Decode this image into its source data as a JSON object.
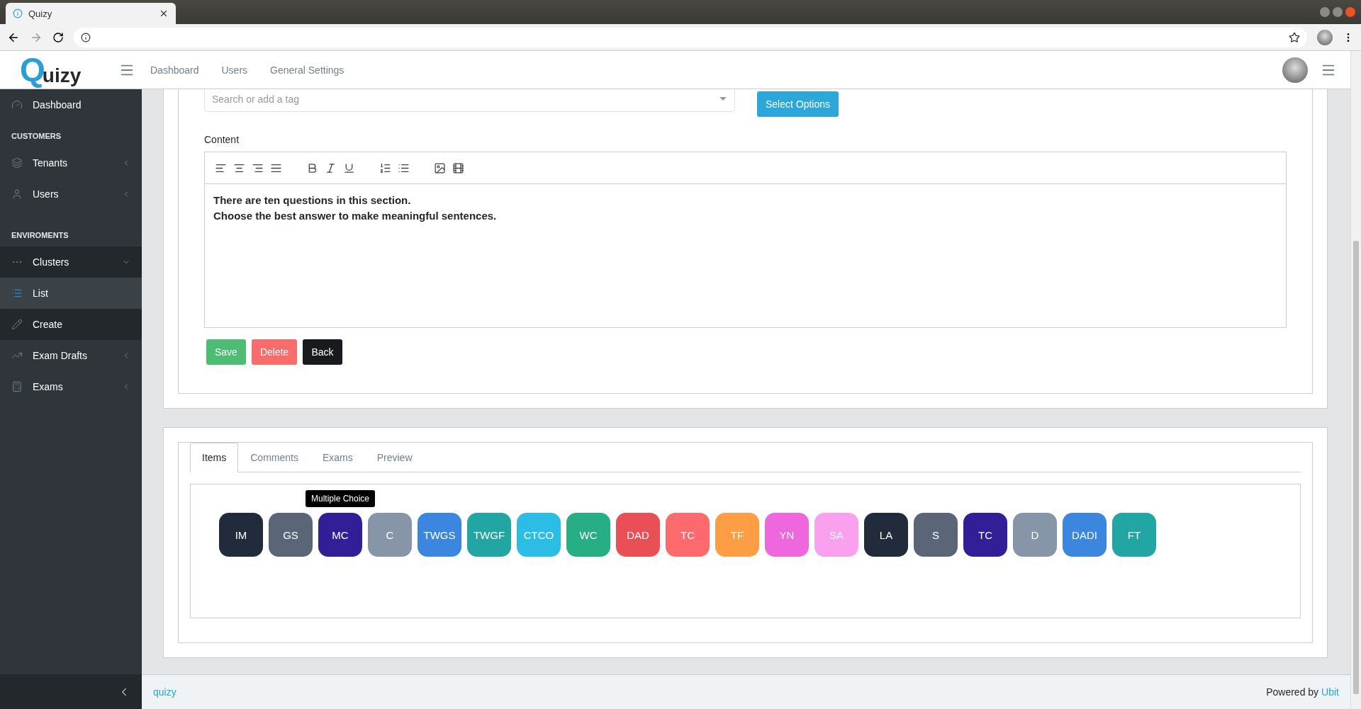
{
  "browser": {
    "tab_title": "Quizy"
  },
  "header": {
    "logo_mark": "Q",
    "logo_text": "uizy",
    "nav": [
      "Dashboard",
      "Users",
      "General Settings"
    ]
  },
  "sidebar": {
    "sections": [
      {
        "items": [
          {
            "label": "Dashboard",
            "submenu": false,
            "selected": false,
            "expanded": false
          }
        ]
      },
      {
        "heading": "CUSTOMERS",
        "items": [
          {
            "label": "Tenants",
            "submenu": true,
            "selected": false,
            "expanded": false
          },
          {
            "label": "Users",
            "submenu": true,
            "selected": false,
            "expanded": false
          }
        ]
      },
      {
        "heading": "ENVIROMENTS",
        "items": [
          {
            "label": "Clusters",
            "submenu": true,
            "selected": false,
            "expanded": true,
            "children": [
              {
                "label": "List",
                "selected": true
              },
              {
                "label": "Create",
                "selected": false
              }
            ]
          },
          {
            "label": "Exam Drafts",
            "submenu": true,
            "selected": false,
            "expanded": false
          },
          {
            "label": "Exams",
            "submenu": true,
            "selected": false,
            "expanded": false
          }
        ]
      }
    ]
  },
  "form": {
    "tag_placeholder": "Search or add a tag",
    "select_button": "Select Options",
    "content_label": "Content",
    "content_lines": [
      "There are ten questions in this section.",
      "Choose the best answer to make meaningful sentences."
    ],
    "buttons": [
      {
        "label": "Save",
        "kind": "success"
      },
      {
        "label": "Delete",
        "kind": "danger"
      },
      {
        "label": "Back",
        "kind": "dark"
      }
    ]
  },
  "tabs": [
    {
      "label": "Items",
      "selected": true
    },
    {
      "label": "Comments",
      "selected": false
    },
    {
      "label": "Exams",
      "selected": false
    },
    {
      "label": "Preview",
      "selected": false
    }
  ],
  "items": [
    {
      "label": "IM",
      "color": "#212b3b"
    },
    {
      "label": "GS",
      "color": "#5a6677"
    },
    {
      "label": "MC",
      "color": "#321e97",
      "tooltip": "Multiple Choice"
    },
    {
      "label": "C",
      "color": "#8795a8"
    },
    {
      "label": "TWGS",
      "color": "#3b87df"
    },
    {
      "label": "TWGF",
      "color": "#21a6a4"
    },
    {
      "label": "CTCO",
      "color": "#2bbde5"
    },
    {
      "label": "WC",
      "color": "#28ae84"
    },
    {
      "label": "DAD",
      "color": "#ea4f56"
    },
    {
      "label": "TC",
      "color": "#fd6a6d"
    },
    {
      "label": "TF",
      "color": "#fd9d44"
    },
    {
      "label": "YN",
      "color": "#ee67dc"
    },
    {
      "label": "SA",
      "color": "#f9a1ef"
    },
    {
      "label": "LA",
      "color": "#212b3b"
    },
    {
      "label": "S",
      "color": "#5a6677"
    },
    {
      "label": "TC",
      "color": "#321e97"
    },
    {
      "label": "D",
      "color": "#8795a8"
    },
    {
      "label": "DADI",
      "color": "#3b87df"
    },
    {
      "label": "FT",
      "color": "#21a6a4"
    }
  ],
  "footer": {
    "left_link": "quizy",
    "powered_by": "Powered by",
    "right_link": "Ubit"
  }
}
